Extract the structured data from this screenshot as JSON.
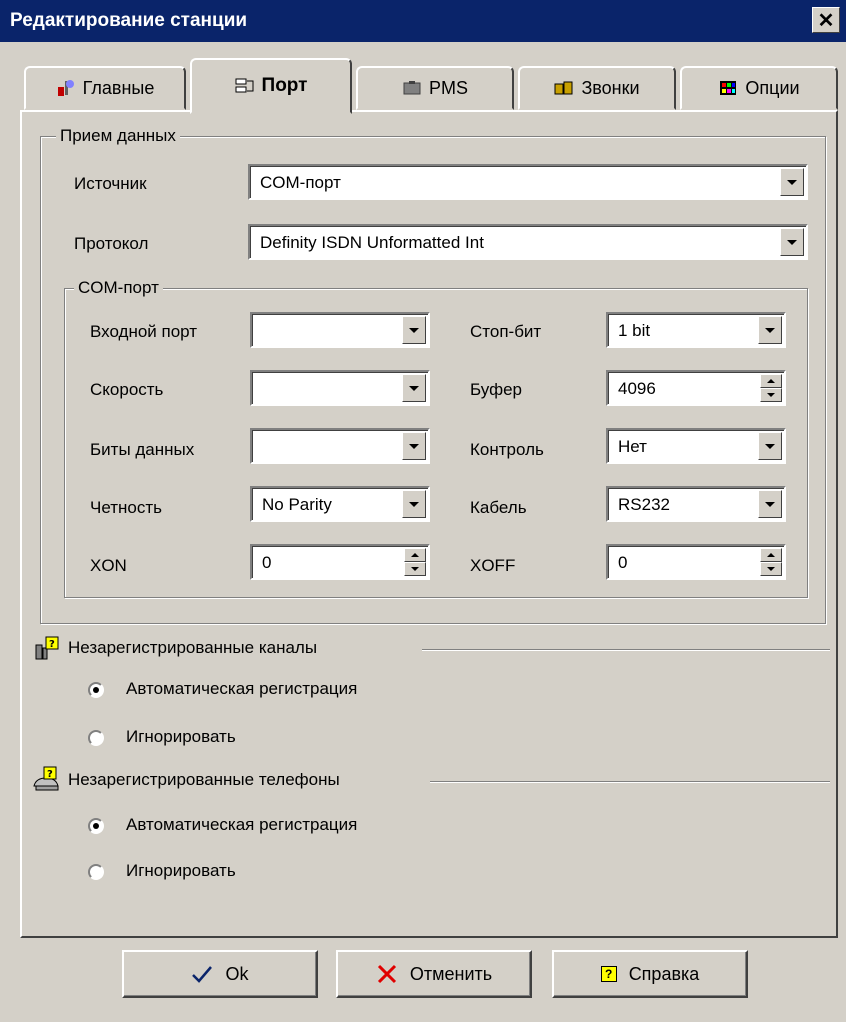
{
  "window": {
    "title": "Редактирование станции",
    "close_label": "✕"
  },
  "tabs": [
    {
      "label": "Главные",
      "icon": "tools-icon"
    },
    {
      "label": "Порт",
      "icon": "port-icon"
    },
    {
      "label": "PMS",
      "icon": "pms-icon"
    },
    {
      "label": "Звонки",
      "icon": "calls-icon"
    },
    {
      "label": "Опции",
      "icon": "options-icon"
    }
  ],
  "active_tab": "Порт",
  "receive": {
    "title": "Прием данных",
    "source_label": "Источник",
    "source_value": "COM-порт",
    "protocol_label": "Протокол",
    "protocol_value": "Definity ISDN Unformatted Int"
  },
  "com": {
    "title": "COM-порт",
    "input_port_label": "Входной порт",
    "input_port_value": "",
    "speed_label": "Скорость",
    "speed_value": "",
    "data_bits_label": "Биты данных",
    "data_bits_value": "",
    "parity_label": "Четность",
    "parity_value": "No Parity",
    "xon_label": "XON",
    "xon_value": "0",
    "stop_bits_label": "Стоп-бит",
    "stop_bits_value": "1 bit",
    "buffer_label": "Буфер",
    "buffer_value": "4096",
    "control_label": "Контроль",
    "control_value": "Нет",
    "cable_label": "Кабель",
    "cable_value": "RS232",
    "xoff_label": "XOFF",
    "xoff_value": "0"
  },
  "channels": {
    "title": "Незарегистрированные каналы",
    "options": [
      "Автоматическая регистрация",
      "Игнорировать"
    ],
    "selected": 0
  },
  "phones": {
    "title": "Незарегистрированные телефоны",
    "options": [
      "Автоматическая регистрация",
      "Игнорировать"
    ],
    "selected": 0
  },
  "buttons": {
    "ok": "Ok",
    "cancel": "Отменить",
    "help": "Справка"
  },
  "colors": {
    "titlebar": "#0a246a",
    "face": "#d4d0c8",
    "ok_check": "#0a246a",
    "cancel_x": "#e00000"
  }
}
